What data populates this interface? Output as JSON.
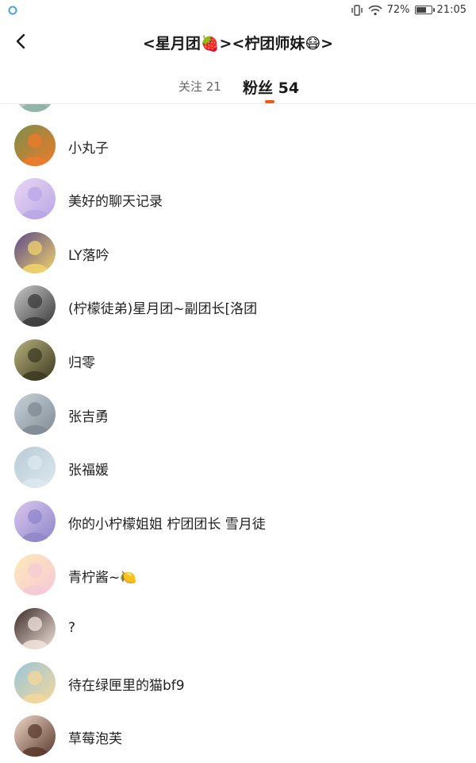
{
  "status_bar": {
    "battery_percent": "72%",
    "battery_level": 0.72,
    "time": "21:05",
    "icons": [
      "vibrate-icon",
      "wifi-icon",
      "battery-icon"
    ]
  },
  "header": {
    "back_icon": "back-arrow-icon",
    "title": "<星月团🍓><柠团师妹😷>"
  },
  "tabs": {
    "follow": "关注 21",
    "fans": "粉丝 54",
    "active": "fans",
    "accent_color": "#f25a1c"
  },
  "fans": [
    {
      "name": "",
      "avatar_colors": [
        "#8fb3a8",
        "#d8e2d2"
      ]
    },
    {
      "name": "小丸子",
      "avatar_colors": [
        "#f07a2a",
        "#7a8f4a"
      ]
    },
    {
      "name": "美好的聊天记录",
      "avatar_colors": [
        "#b9a6e6",
        "#e9d8f3"
      ]
    },
    {
      "name": "LY落吟",
      "avatar_colors": [
        "#f2d36b",
        "#5b4a8a"
      ]
    },
    {
      "name": "(柠檬徒弟)星月团~副团长[洛团",
      "avatar_colors": [
        "#3a3a3a",
        "#c8c8c8"
      ]
    },
    {
      "name": "归零",
      "avatar_colors": [
        "#3d3a22",
        "#b6b07a"
      ]
    },
    {
      "name": "张吉勇",
      "avatar_colors": [
        "#7f8a94",
        "#c9d3da"
      ]
    },
    {
      "name": "张福媛",
      "avatar_colors": [
        "#dce8ef",
        "#b8cbd6"
      ]
    },
    {
      "name": "你的小柠檬姐姐 柠团团长 雪月徒",
      "avatar_colors": [
        "#8f86c9",
        "#d9c7ee"
      ]
    },
    {
      "name": "青柠酱~🍋",
      "avatar_colors": [
        "#f6c9d6",
        "#fde9b8"
      ]
    },
    {
      "name": "?",
      "avatar_colors": [
        "#f2e3dd",
        "#3b2a26"
      ]
    },
    {
      "name": "待在绿匣里的猫bf9",
      "avatar_colors": [
        "#f4d79a",
        "#9ac6d9"
      ]
    },
    {
      "name": "草莓泡芙",
      "avatar_colors": [
        "#5a3a2e",
        "#f0d6c6"
      ]
    }
  ]
}
